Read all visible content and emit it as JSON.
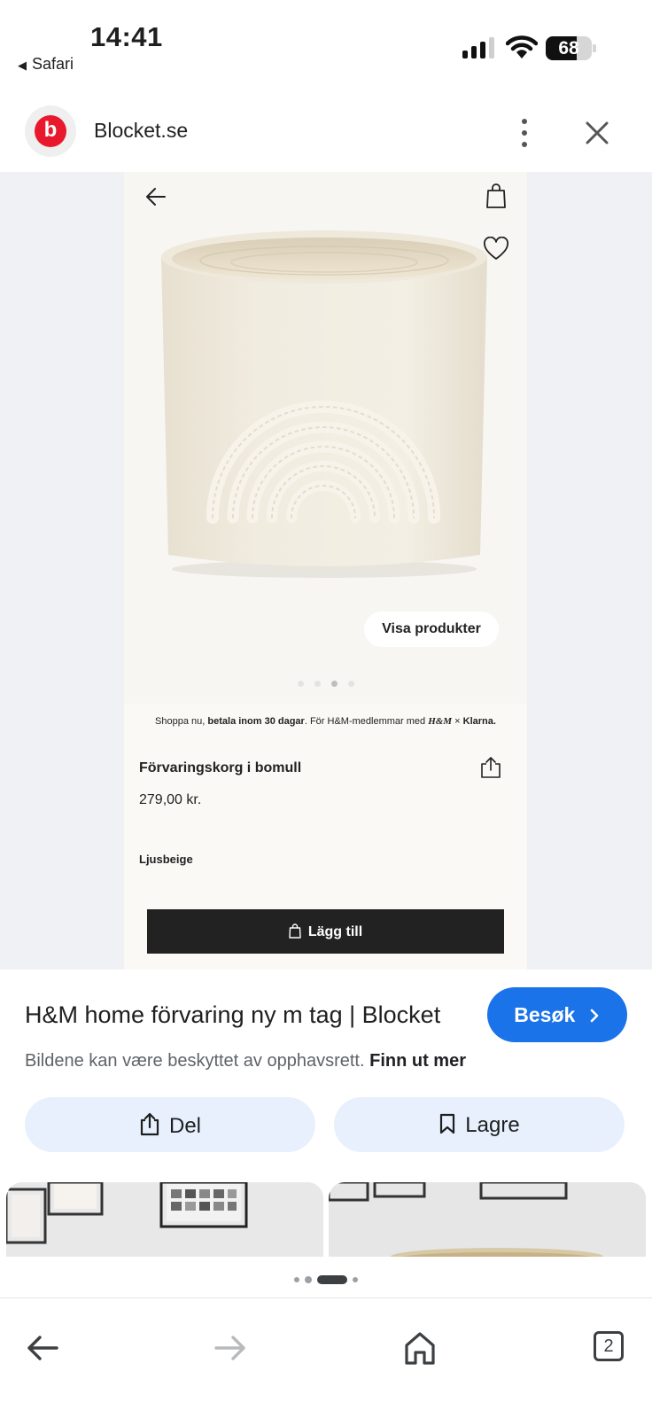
{
  "status_bar": {
    "time": "14:41",
    "back_app": "Safari",
    "battery": "68",
    "battery_level": 0.68
  },
  "site_bar": {
    "logo_letter": "b",
    "site_name": "Blocket.se",
    "brand_color": "#e8192c",
    "more_icon": "more-vert-icon",
    "close_icon": "close-icon"
  },
  "preview": {
    "back_icon": "arrow-left-icon",
    "bag_icon": "shopping-bag-icon",
    "favorite_icon": "heart-icon",
    "visa_produkter": "Visa produkter",
    "image_dots": {
      "count": 4,
      "active": 2
    },
    "pay_line": {
      "part1": "Shoppa nu, ",
      "bold1": "betala inom 30 dagar",
      "part2": ". För H&M-medlemmar med ",
      "brand": "H&M",
      "part3": " × ",
      "bold2": "Klarna."
    },
    "product_name": "Förvaringskorg i bomull",
    "price": "279,00 kr.",
    "color_name": "Ljusbeige",
    "add_button": "Lägg till"
  },
  "result": {
    "title": "H&M home förvaring ny m tag | Blocket",
    "visit_button": "Besøk",
    "copyright_text": "Bildene kan være beskyttet av opphavsrett.",
    "copyright_link": "Finn ut mer",
    "share_button": "Del",
    "save_button": "Lagre",
    "accent_color": "#1a73e8"
  },
  "pager": {
    "count": 4,
    "active": 2
  },
  "nav": {
    "back_icon": "arrow-left-icon",
    "forward_icon": "arrow-right-icon",
    "home_icon": "home-icon",
    "tabs_count": "2"
  }
}
